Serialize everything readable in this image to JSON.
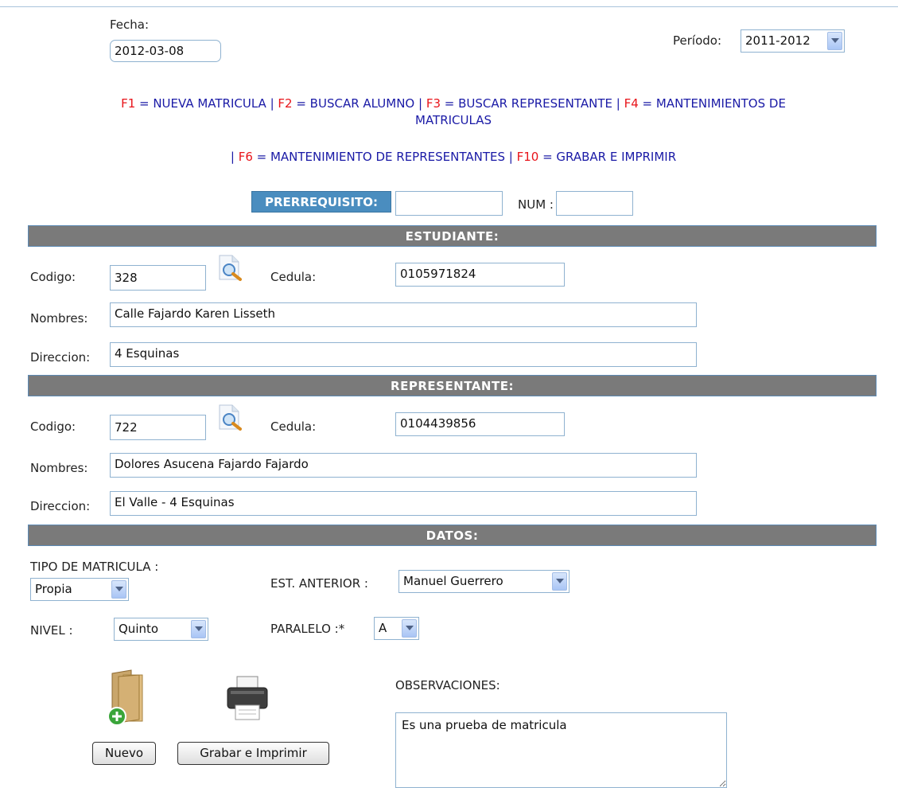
{
  "header": {
    "fecha_label": "Fecha:",
    "fecha_value": "2012-03-08",
    "periodo_label": "Período:",
    "periodo_value": "2011-2012"
  },
  "shortcuts": {
    "line1": [
      {
        "key": "F1",
        "text": " = NUEVA MATRICULA | "
      },
      {
        "key": "F2",
        "text": " = BUSCAR ALUMNO | "
      },
      {
        "key": "F3",
        "text": " = BUSCAR REPRESENTANTE | "
      },
      {
        "key": "F4",
        "text": " = MANTENIMIENTOS DE"
      }
    ],
    "line1_cont": "MATRICULAS",
    "line2_prefix": "| ",
    "line2": [
      {
        "key": "F6",
        "text": " = MANTENIMIENTO DE REPRESENTANTES | "
      },
      {
        "key": "F10",
        "text": " = GRABAR E IMPRIMIR"
      }
    ]
  },
  "prerequisito": {
    "label": "PRERREQUISITO:",
    "value": "",
    "num_label": "NUM :",
    "num_value": ""
  },
  "estudiante": {
    "title": "ESTUDIANTE:",
    "codigo_label": "Codigo:",
    "codigo_value": "328",
    "cedula_label": "Cedula:",
    "cedula_value": "0105971824",
    "nombres_label": "Nombres:",
    "nombres_value": "Calle Fajardo Karen Lisseth",
    "direccion_label": "Direccion:",
    "direccion_value": "4 Esquinas"
  },
  "representante": {
    "title": "REPRESENTANTE:",
    "codigo_label": "Codigo:",
    "codigo_value": "722",
    "cedula_label": "Cedula:",
    "cedula_value": "0104439856",
    "nombres_label": "Nombres:",
    "nombres_value": "Dolores Asucena Fajardo Fajardo",
    "direccion_label": "Direccion:",
    "direccion_value": "El Valle - 4 Esquinas"
  },
  "datos": {
    "title": "DATOS:",
    "tipo_label": "TIPO DE MATRICULA :",
    "tipo_value": "Propia",
    "est_anterior_label": "EST. ANTERIOR :",
    "est_anterior_value": "Manuel Guerrero",
    "nivel_label": "NIVEL :",
    "nivel_value": "Quinto",
    "paralelo_label": "PARALELO :*",
    "paralelo_value": "A"
  },
  "actions": {
    "nuevo_label": "Nuevo",
    "grabar_label": "Grabar e Imprimir",
    "observaciones_label": "OBSERVACIONES:",
    "observaciones_value": "Es una prueba de matricula"
  },
  "colors": {
    "section_bar": "#7a7a7a",
    "prereq_bg": "#4a8dbf",
    "shortcut_key": "#e8141a",
    "shortcut_text": "#1a1aa6"
  }
}
